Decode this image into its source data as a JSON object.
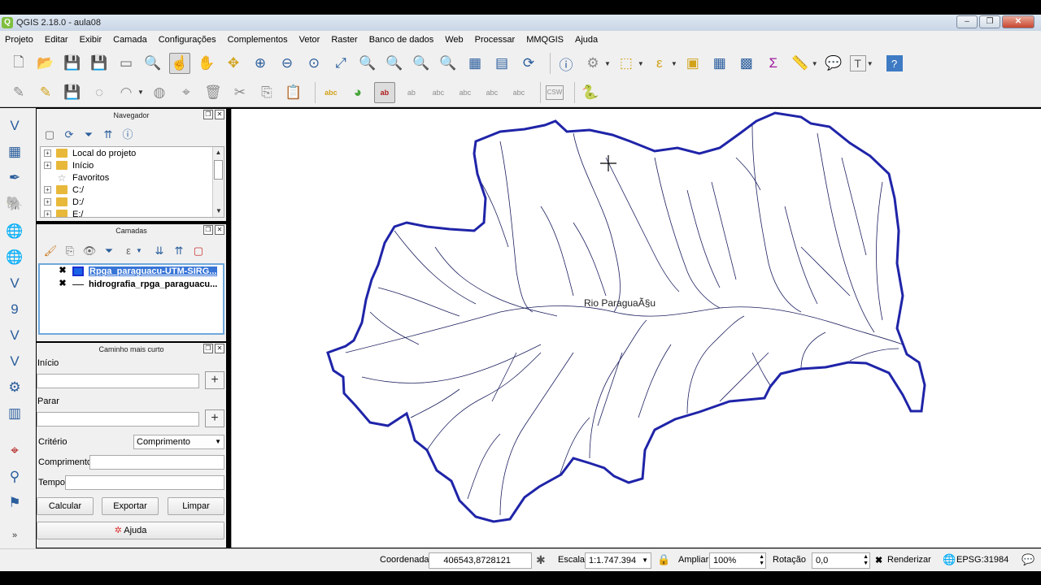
{
  "window": {
    "title": "QGIS 2.18.0 - aula08",
    "app_icon": "Q",
    "min": "–",
    "max": "❐",
    "close": "✕"
  },
  "menu": [
    "Projeto",
    "Editar",
    "Exibir",
    "Camada",
    "Configurações",
    "Complementos",
    "Vetor",
    "Raster",
    "Banco de dados",
    "Web",
    "Processar",
    "MMQGIS",
    "Ajuda"
  ],
  "toolbar": {
    "csw_label": "CSW",
    "text_tool_glyph": "T"
  },
  "navigator": {
    "title": "Navegador",
    "items": [
      {
        "label": "Local do projeto",
        "expand": "+"
      },
      {
        "label": "Início",
        "expand": "+"
      },
      {
        "label": "Favoritos",
        "expand": ""
      },
      {
        "label": "C:/",
        "expand": "+"
      },
      {
        "label": "D:/",
        "expand": "+"
      },
      {
        "label": "E:/",
        "expand": "+"
      }
    ]
  },
  "layers": {
    "title": "Camadas",
    "items": [
      {
        "label": "Rpga_paraguacu-UTM-SIRG...",
        "checked": "✖",
        "selected": true
      },
      {
        "label": "hidrografia_rpga_paraguacu...",
        "checked": "✖",
        "selected": false
      }
    ]
  },
  "shortest_path": {
    "title": "Caminho mais curto",
    "start_label": "Início",
    "stop_label": "Parar",
    "criterion_label": "Critério",
    "criterion_value": "Comprimento",
    "length_label": "Comprimento",
    "time_label": "Tempo",
    "calc_button": "Calcular",
    "export_button": "Exportar",
    "clear_button": "Limpar",
    "help_button": "Ajuda"
  },
  "map": {
    "label": "Rio ParaguaÃ§u"
  },
  "status": {
    "coord_label": "Coordenada",
    "coord_value": "406543,8728121",
    "scale_label": "Escala",
    "scale_value": "1:1.747.394",
    "zoom_label": "Ampliar",
    "zoom_value": "100%",
    "rotation_label": "Rotação",
    "rotation_value": "0,0",
    "render_label": "Renderizar",
    "render_checked": "✖",
    "crs": "EPSG:31984"
  }
}
